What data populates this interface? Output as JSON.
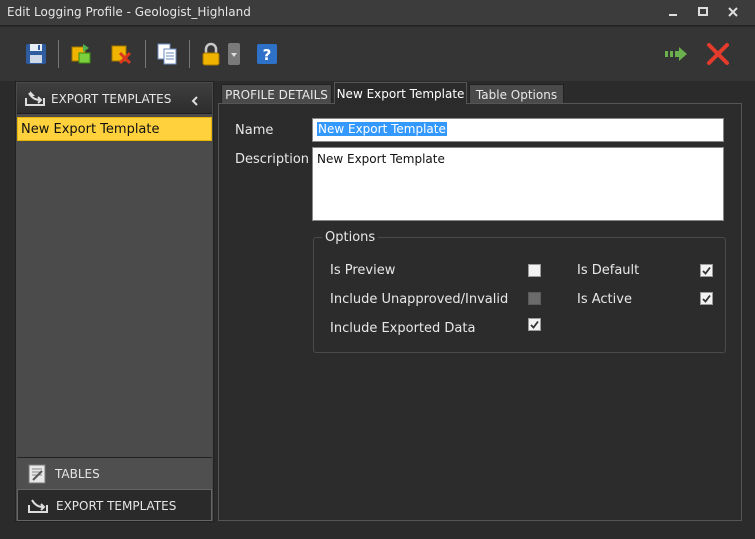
{
  "window": {
    "title": "Edit Logging Profile - Geologist_Highland",
    "minimize_icon": "minimize-icon",
    "maximize_icon": "maximize-icon",
    "close_icon": "close-icon"
  },
  "toolbar": {
    "icons": [
      "save-icon",
      "import-icon",
      "delete-icon",
      "copy-icon",
      "lock-icon",
      "dropdown-icon",
      "help-icon"
    ],
    "right_icons": [
      "next-icon",
      "cancel-icon"
    ],
    "colors": {
      "accent_green": "#6ab04c",
      "cancel_red": "#e53b2c"
    }
  },
  "sidebar": {
    "header": "EXPORT TEMPLATES",
    "items": [
      "New Export Template"
    ],
    "nav": [
      {
        "label": "TABLES",
        "icon": "tables-icon"
      },
      {
        "label": "EXPORT TEMPLATES",
        "icon": "export-templates-icon"
      }
    ],
    "selected_color": "#ffd23d"
  },
  "tabs": [
    {
      "label": "PROFILE DETAILS",
      "active": false
    },
    {
      "label": "New Export Template",
      "active": true
    },
    {
      "label": "Table Options",
      "active": false
    }
  ],
  "form": {
    "name_label": "Name",
    "name_value": "New Export Template",
    "description_label": "Description",
    "description_value": "New Export Template"
  },
  "options": {
    "legend": "Options",
    "left": [
      {
        "label": "Is Preview",
        "checked": false,
        "enabled": true
      },
      {
        "label": "Include Unapproved/Invalid",
        "checked": false,
        "enabled": false
      },
      {
        "label": "Include Exported Data",
        "checked": true,
        "enabled": true
      }
    ],
    "right": [
      {
        "label": "Is Default",
        "checked": true,
        "enabled": true
      },
      {
        "label": "Is Active",
        "checked": true,
        "enabled": true
      }
    ]
  }
}
